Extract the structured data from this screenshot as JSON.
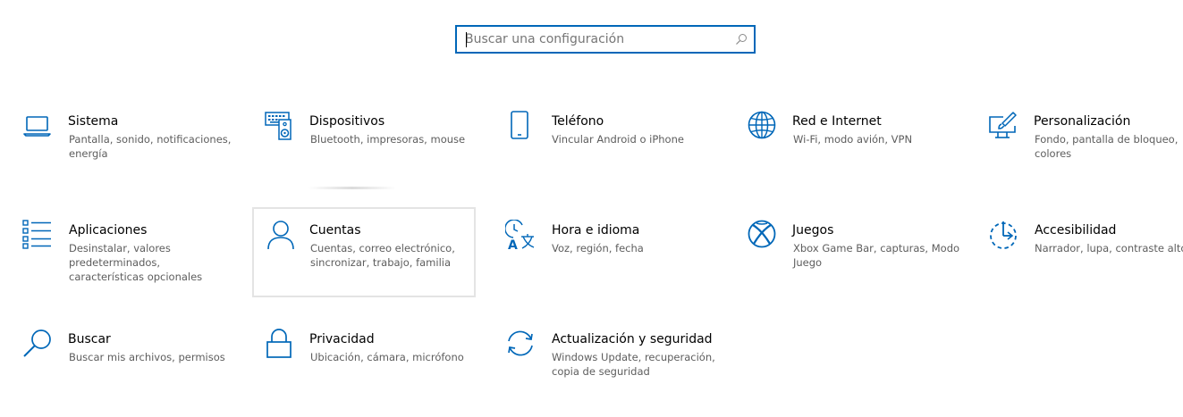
{
  "search": {
    "placeholder": "Buscar una configuración",
    "value": ""
  },
  "accent_color": "#0067b8",
  "categories": [
    {
      "title": "Sistema",
      "description": "Pantalla, sonido, notificaciones,\nenergía",
      "icon": "laptop-icon"
    },
    {
      "title": "Dispositivos",
      "description": "Bluetooth, impresoras, mouse",
      "icon": "keyboard-speaker-icon"
    },
    {
      "title": "Teléfono",
      "description": "Vincular Android o iPhone",
      "icon": "phone-icon"
    },
    {
      "title": "Red e Internet",
      "description": "Wi-Fi, modo avión, VPN",
      "icon": "globe-icon"
    },
    {
      "title": "Personalización",
      "description": "Fondo, pantalla de bloqueo,\ncolores",
      "icon": "paint-brush-icon"
    },
    {
      "title": "Aplicaciones",
      "description": "Desinstalar, valores\npredeterminados,\ncaracterísticas opcionales",
      "icon": "apps-list-icon"
    },
    {
      "title": "Cuentas",
      "description": "Cuentas, correo electrónico,\nsincronizar, trabajo, familia",
      "icon": "person-icon"
    },
    {
      "title": "Hora e idioma",
      "description": "Voz, región, fecha",
      "icon": "time-language-icon"
    },
    {
      "title": "Juegos",
      "description": "Xbox Game Bar, capturas, Modo\nJuego",
      "icon": "xbox-icon"
    },
    {
      "title": "Accesibilidad",
      "description": "Narrador, lupa, contraste alto",
      "icon": "accessibility-icon"
    },
    {
      "title": "Buscar",
      "description": "Buscar mis archivos, permisos",
      "icon": "magnifier-icon"
    },
    {
      "title": "Privacidad",
      "description": "Ubicación, cámara, micrófono",
      "icon": "lock-icon"
    },
    {
      "title": "Actualización y seguridad",
      "description": "Windows Update, recuperación,\ncopia de seguridad",
      "icon": "sync-icon"
    }
  ]
}
